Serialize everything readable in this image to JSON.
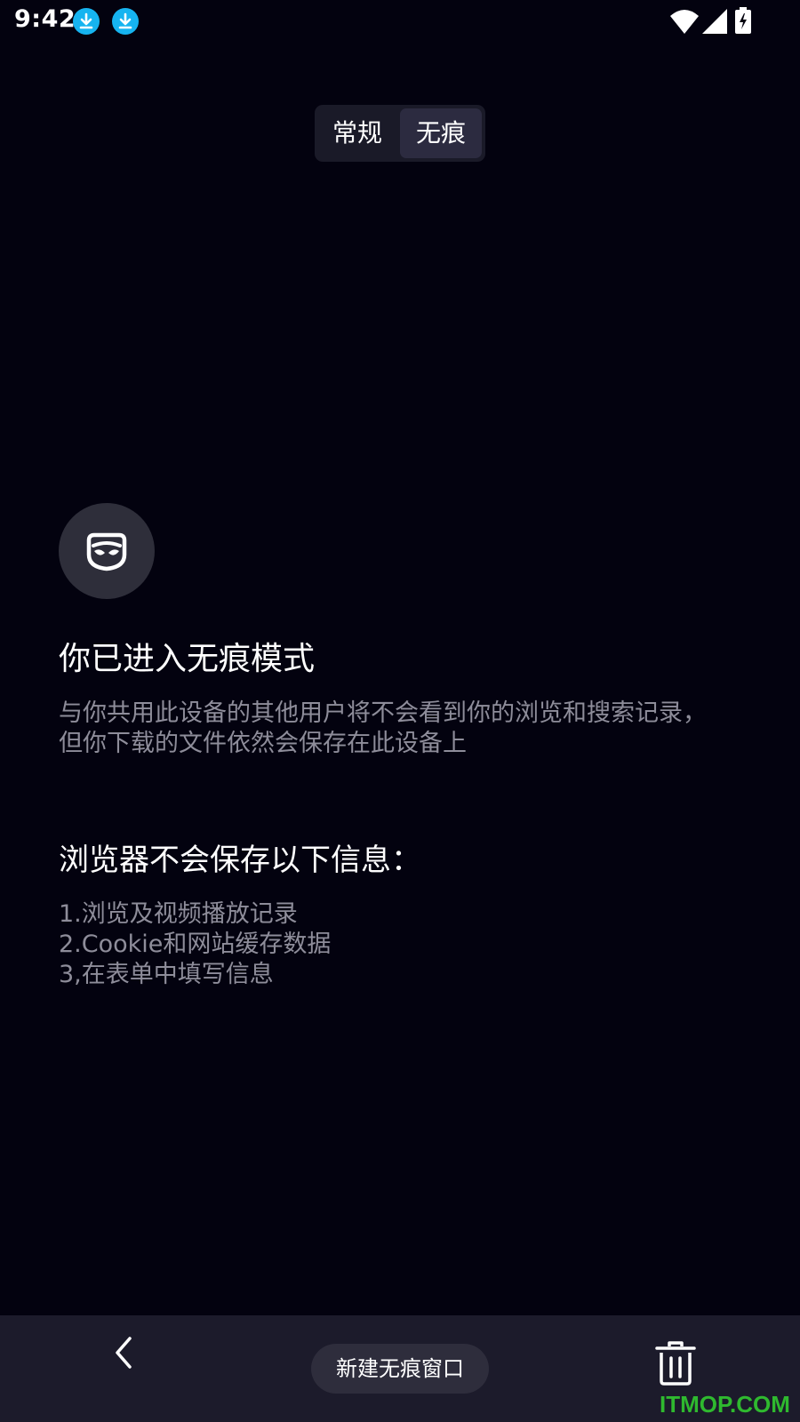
{
  "status_bar": {
    "time": "9:42",
    "icons": [
      "download-icon",
      "download-icon",
      "wifi-icon",
      "signal-icon",
      "battery-charging-icon"
    ]
  },
  "mode_toggle": {
    "options": [
      "常规",
      "无痕"
    ],
    "selected": "无痕"
  },
  "main": {
    "icon": "mask-icon",
    "heading": "你已进入无痕模式",
    "description_lines": [
      "与你共用此设备的其他用户将不会看到你的浏览和搜索记录，",
      "但你下载的文件依然会保存在此设备上"
    ],
    "subheading": "浏览器不会保存以下信息：",
    "items": [
      "1.浏览及视频播放记录",
      "2.Cookie和网站缓存数据",
      "3,在表单中填写信息"
    ]
  },
  "bottom_bar": {
    "back_icon": "chevron-left-icon",
    "new_window_label": "新建无痕窗口",
    "delete_icon": "trash-icon"
  },
  "watermark": "ITMOP.COM",
  "colors": {
    "background": "#03020f",
    "accent_download": "#16b4f0",
    "watermark": "#2fb92f"
  }
}
